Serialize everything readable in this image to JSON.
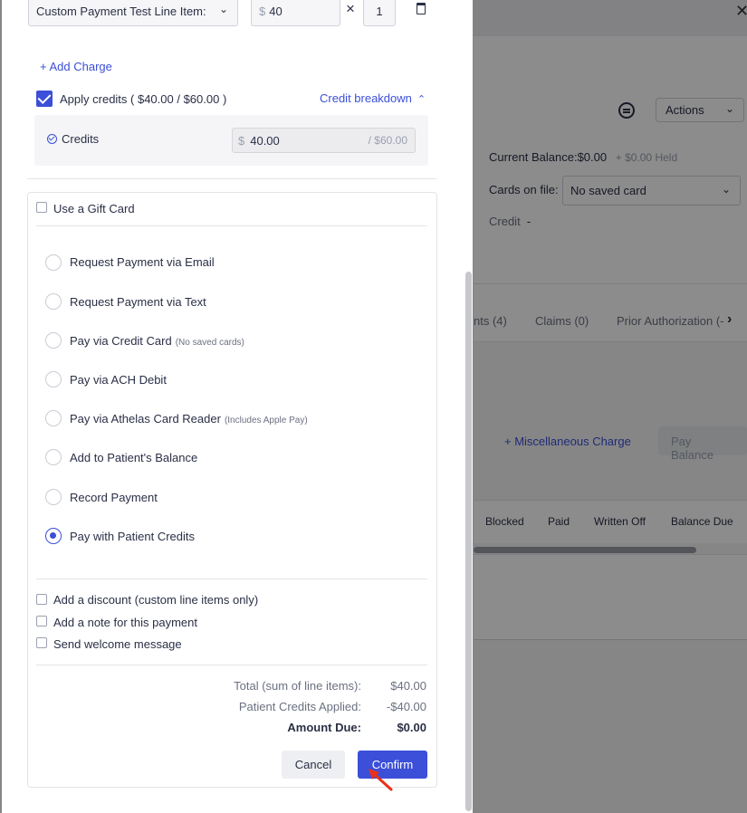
{
  "background": {
    "actions_label": "Actions",
    "balance_label": "Current Balance:",
    "balance_value": "$0.00",
    "held": "+ $0.00 Held",
    "cards_label": "Cards on file:",
    "cards_value": "No saved card",
    "credit_label": "Credit",
    "credit_value": "-",
    "tabs": [
      "nts (4)",
      "Claims (0)",
      "Prior Authorization (-"
    ],
    "misc_charge": "+ Miscellaneous Charge",
    "pay_balance": "Pay Balance",
    "columns": [
      "Blocked",
      "Paid",
      "Written Off",
      "Balance Due"
    ]
  },
  "line_item": {
    "name": "Custom Payment Test Line Item:",
    "currency": "$",
    "amount": "40",
    "times": "×",
    "quantity": "1"
  },
  "add_charge": "+ Add Charge",
  "apply_credits": {
    "label": "Apply credits ( $40.00 / $60.00 )",
    "breakdown_label": "Credit breakdown",
    "credits_label": "Credits",
    "currency": "$",
    "value": "40.00",
    "max": "/ $60.00"
  },
  "gift_card_label": "Use a Gift Card",
  "payment_options": [
    {
      "label": "Request Payment via Email",
      "note": ""
    },
    {
      "label": "Request Payment via Text",
      "note": ""
    },
    {
      "label": "Pay via Credit Card",
      "note": "(No saved cards)"
    },
    {
      "label": "Pay via ACH Debit",
      "note": ""
    },
    {
      "label": "Pay via Athelas Card Reader",
      "note": "(Includes Apple Pay)"
    },
    {
      "label": "Add to Patient's Balance",
      "note": ""
    },
    {
      "label": "Record Payment",
      "note": ""
    },
    {
      "label": "Pay with Patient Credits",
      "note": ""
    }
  ],
  "selected_option": "Pay with Patient Credits",
  "extras": {
    "discount": "Add a discount (custom line items only)",
    "note": "Add a note for this payment",
    "welcome": "Send welcome message"
  },
  "summary": {
    "total_label": "Total (sum of line items):",
    "total_value": "$40.00",
    "credits_label": "Patient Credits Applied:",
    "credits_value": "-$40.00",
    "due_label": "Amount Due:",
    "due_value": "$0.00"
  },
  "buttons": {
    "cancel": "Cancel",
    "confirm": "Confirm"
  },
  "colors": {
    "accent": "#3b4fd8",
    "cursor": "#e8301c"
  }
}
